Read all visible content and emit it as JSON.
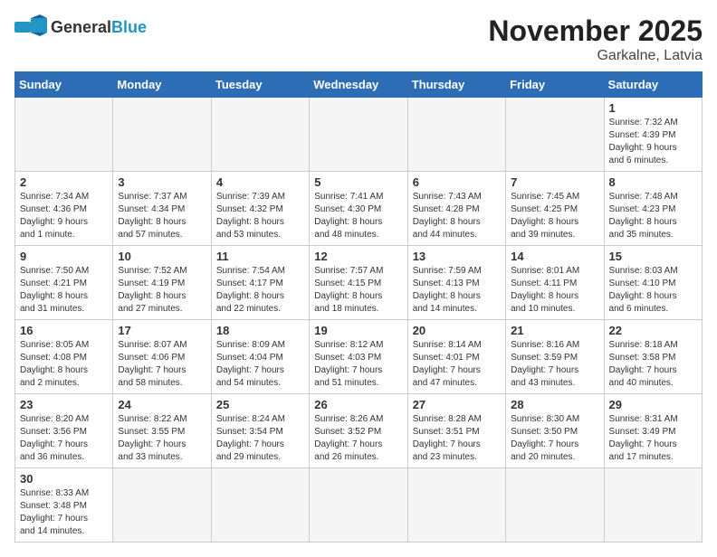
{
  "header": {
    "logo_general": "General",
    "logo_blue": "Blue",
    "month_year": "November 2025",
    "location": "Garkalne, Latvia"
  },
  "weekdays": [
    "Sunday",
    "Monday",
    "Tuesday",
    "Wednesday",
    "Thursday",
    "Friday",
    "Saturday"
  ],
  "weeks": [
    [
      {
        "day": "",
        "info": ""
      },
      {
        "day": "",
        "info": ""
      },
      {
        "day": "",
        "info": ""
      },
      {
        "day": "",
        "info": ""
      },
      {
        "day": "",
        "info": ""
      },
      {
        "day": "",
        "info": ""
      },
      {
        "day": "1",
        "info": "Sunrise: 7:32 AM\nSunset: 4:39 PM\nDaylight: 9 hours\nand 6 minutes."
      }
    ],
    [
      {
        "day": "2",
        "info": "Sunrise: 7:34 AM\nSunset: 4:36 PM\nDaylight: 9 hours\nand 1 minute."
      },
      {
        "day": "3",
        "info": "Sunrise: 7:37 AM\nSunset: 4:34 PM\nDaylight: 8 hours\nand 57 minutes."
      },
      {
        "day": "4",
        "info": "Sunrise: 7:39 AM\nSunset: 4:32 PM\nDaylight: 8 hours\nand 53 minutes."
      },
      {
        "day": "5",
        "info": "Sunrise: 7:41 AM\nSunset: 4:30 PM\nDaylight: 8 hours\nand 48 minutes."
      },
      {
        "day": "6",
        "info": "Sunrise: 7:43 AM\nSunset: 4:28 PM\nDaylight: 8 hours\nand 44 minutes."
      },
      {
        "day": "7",
        "info": "Sunrise: 7:45 AM\nSunset: 4:25 PM\nDaylight: 8 hours\nand 39 minutes."
      },
      {
        "day": "8",
        "info": "Sunrise: 7:48 AM\nSunset: 4:23 PM\nDaylight: 8 hours\nand 35 minutes."
      }
    ],
    [
      {
        "day": "9",
        "info": "Sunrise: 7:50 AM\nSunset: 4:21 PM\nDaylight: 8 hours\nand 31 minutes."
      },
      {
        "day": "10",
        "info": "Sunrise: 7:52 AM\nSunset: 4:19 PM\nDaylight: 8 hours\nand 27 minutes."
      },
      {
        "day": "11",
        "info": "Sunrise: 7:54 AM\nSunset: 4:17 PM\nDaylight: 8 hours\nand 22 minutes."
      },
      {
        "day": "12",
        "info": "Sunrise: 7:57 AM\nSunset: 4:15 PM\nDaylight: 8 hours\nand 18 minutes."
      },
      {
        "day": "13",
        "info": "Sunrise: 7:59 AM\nSunset: 4:13 PM\nDaylight: 8 hours\nand 14 minutes."
      },
      {
        "day": "14",
        "info": "Sunrise: 8:01 AM\nSunset: 4:11 PM\nDaylight: 8 hours\nand 10 minutes."
      },
      {
        "day": "15",
        "info": "Sunrise: 8:03 AM\nSunset: 4:10 PM\nDaylight: 8 hours\nand 6 minutes."
      }
    ],
    [
      {
        "day": "16",
        "info": "Sunrise: 8:05 AM\nSunset: 4:08 PM\nDaylight: 8 hours\nand 2 minutes."
      },
      {
        "day": "17",
        "info": "Sunrise: 8:07 AM\nSunset: 4:06 PM\nDaylight: 7 hours\nand 58 minutes."
      },
      {
        "day": "18",
        "info": "Sunrise: 8:09 AM\nSunset: 4:04 PM\nDaylight: 7 hours\nand 54 minutes."
      },
      {
        "day": "19",
        "info": "Sunrise: 8:12 AM\nSunset: 4:03 PM\nDaylight: 7 hours\nand 51 minutes."
      },
      {
        "day": "20",
        "info": "Sunrise: 8:14 AM\nSunset: 4:01 PM\nDaylight: 7 hours\nand 47 minutes."
      },
      {
        "day": "21",
        "info": "Sunrise: 8:16 AM\nSunset: 3:59 PM\nDaylight: 7 hours\nand 43 minutes."
      },
      {
        "day": "22",
        "info": "Sunrise: 8:18 AM\nSunset: 3:58 PM\nDaylight: 7 hours\nand 40 minutes."
      }
    ],
    [
      {
        "day": "23",
        "info": "Sunrise: 8:20 AM\nSunset: 3:56 PM\nDaylight: 7 hours\nand 36 minutes."
      },
      {
        "day": "24",
        "info": "Sunrise: 8:22 AM\nSunset: 3:55 PM\nDaylight: 7 hours\nand 33 minutes."
      },
      {
        "day": "25",
        "info": "Sunrise: 8:24 AM\nSunset: 3:54 PM\nDaylight: 7 hours\nand 29 minutes."
      },
      {
        "day": "26",
        "info": "Sunrise: 8:26 AM\nSunset: 3:52 PM\nDaylight: 7 hours\nand 26 minutes."
      },
      {
        "day": "27",
        "info": "Sunrise: 8:28 AM\nSunset: 3:51 PM\nDaylight: 7 hours\nand 23 minutes."
      },
      {
        "day": "28",
        "info": "Sunrise: 8:30 AM\nSunset: 3:50 PM\nDaylight: 7 hours\nand 20 minutes."
      },
      {
        "day": "29",
        "info": "Sunrise: 8:31 AM\nSunset: 3:49 PM\nDaylight: 7 hours\nand 17 minutes."
      }
    ],
    [
      {
        "day": "30",
        "info": "Sunrise: 8:33 AM\nSunset: 3:48 PM\nDaylight: 7 hours\nand 14 minutes."
      },
      {
        "day": "",
        "info": ""
      },
      {
        "day": "",
        "info": ""
      },
      {
        "day": "",
        "info": ""
      },
      {
        "day": "",
        "info": ""
      },
      {
        "day": "",
        "info": ""
      },
      {
        "day": "",
        "info": ""
      }
    ]
  ]
}
